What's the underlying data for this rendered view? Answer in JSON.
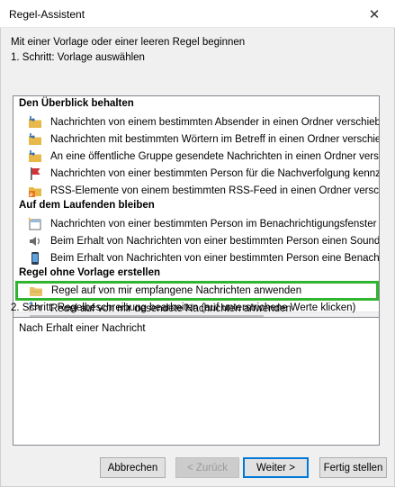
{
  "window": {
    "title": "Regel-Assistent",
    "close_glyph": "✕"
  },
  "intro": "Mit einer Vorlage oder einer leeren Regel beginnen",
  "step1_label": "1. Schritt: Vorlage auswählen",
  "templates": {
    "groups": [
      {
        "label": "Den Überblick behalten",
        "items": [
          {
            "icon": "folder-move-icon",
            "label": "Nachrichten von einem bestimmten Absender in einen Ordner verschieben"
          },
          {
            "icon": "folder-move-icon",
            "label": "Nachrichten mit bestimmten Wörtern im Betreff in einen Ordner verschieben"
          },
          {
            "icon": "folder-move-icon",
            "label": "An eine öffentliche Gruppe gesendete Nachrichten in einen Ordner verschieben"
          },
          {
            "icon": "flag-icon",
            "label": "Nachrichten von einer bestimmten Person für die Nachverfolgung kennzeichnen"
          },
          {
            "icon": "rss-folder-icon",
            "label": "RSS-Elemente von einem bestimmten RSS-Feed in einen Ordner verschieben"
          }
        ]
      },
      {
        "label": "Auf dem Laufenden bleiben",
        "items": [
          {
            "icon": "new-item-window-icon",
            "label": "Nachrichten von einer bestimmten Person im Benachrichtigungsfenster anzeigen"
          },
          {
            "icon": "speaker-icon",
            "label": "Beim Erhalt von Nachrichten von einer bestimmten Person einen Sound wiedergeben"
          },
          {
            "icon": "mobile-device-icon",
            "label": "Beim Erhalt von Nachrichten von einer bestimmten Person eine Benachrichtigung senden"
          }
        ]
      },
      {
        "label": "Regel ohne Vorlage erstellen",
        "items": [
          {
            "icon": "received-mail-rule-icon",
            "label": "Regel auf von mir empfangene Nachrichten anwenden",
            "selected": true
          },
          {
            "icon": "sent-mail-rule-icon",
            "label": "Regel auf von mir gesendete Nachrichten anwenden"
          }
        ]
      }
    ]
  },
  "step2_label": "2. Schritt: Regelbeschreibung bearbeiten (auf unterstrichene Werte klicken)",
  "description": "Nach Erhalt einer Nachricht",
  "buttons": {
    "cancel": "Abbrechen",
    "back": "< Zurück",
    "next": "Weiter >",
    "finish": "Fertig stellen"
  },
  "colors": {
    "selection_outline": "#2fb52f",
    "folder_yellow": "#e8b94a",
    "arrow_blue": "#2b6cb0",
    "flag_red": "#d13438",
    "rss_orange": "#e8781b",
    "default_button_border": "#0078d7"
  }
}
